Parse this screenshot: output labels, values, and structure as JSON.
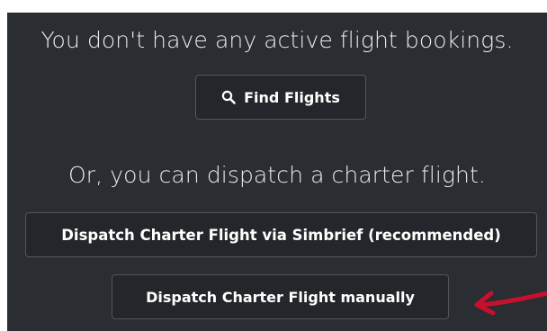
{
  "messages": {
    "no_bookings": "You don't have any active flight bookings.",
    "charter_prompt": "Or, you can dispatch a charter flight."
  },
  "buttons": {
    "find_flights": "Find Flights",
    "dispatch_simbrief": "Dispatch Charter Flight via Simbrief (recommended)",
    "dispatch_manual": "Dispatch Charter Flight manually"
  },
  "icons": {
    "find_flights": "search-icon",
    "annotation": "red-arrow-icon"
  },
  "colors": {
    "panel_bg": "#2a2d31",
    "button_bg": "#23262a",
    "button_border": "#52565c",
    "arrow": "#c8102e"
  }
}
